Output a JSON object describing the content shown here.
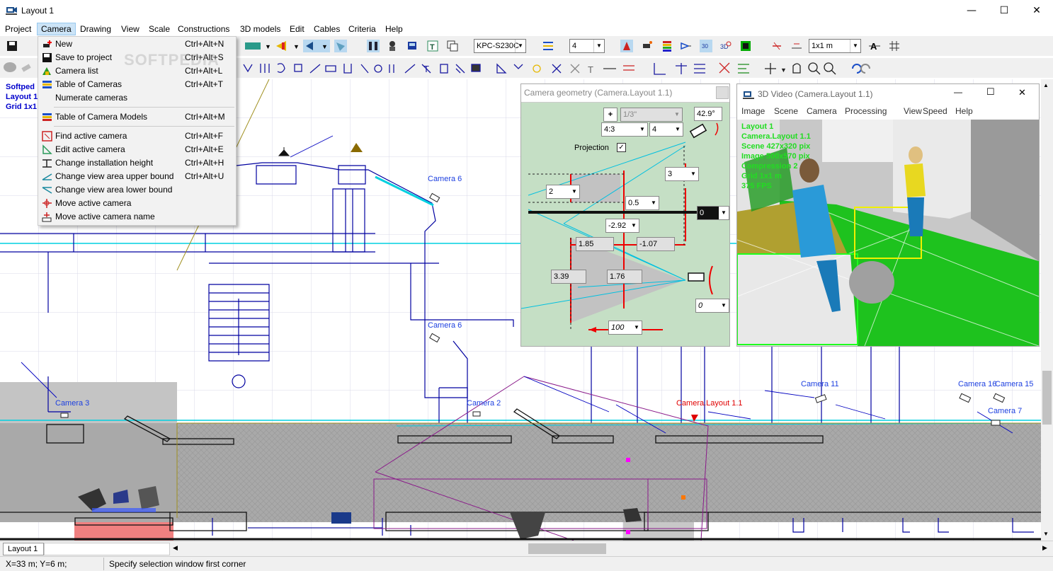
{
  "window": {
    "title": "Layout 1"
  },
  "menubar": [
    "Project",
    "Camera",
    "Drawing",
    "View",
    "Scale",
    "Constructions",
    "3D models",
    "Edit",
    "Cables",
    "Criteria",
    "Help"
  ],
  "toolbar": {
    "camera_model": "KPC-S230C",
    "number_combo": "4",
    "grid_combo": "1x1 m"
  },
  "camera_menu": [
    {
      "label": "New",
      "shortcut": "Ctrl+Alt+N",
      "icon": "new-camera-icon"
    },
    {
      "label": "Save to project",
      "shortcut": "Ctrl+Alt+S",
      "icon": "save-icon"
    },
    {
      "label": "Camera list",
      "shortcut": "Ctrl+Alt+L",
      "icon": "camera-list-icon"
    },
    {
      "label": "Table of Cameras",
      "shortcut": "Ctrl+Alt+T",
      "icon": "table-icon"
    },
    {
      "label": "Numerate cameras",
      "shortcut": "",
      "icon": ""
    },
    {
      "label": "Table of Camera Models",
      "shortcut": "Ctrl+Alt+M",
      "icon": "table-icon"
    },
    {
      "label": "Find active camera",
      "shortcut": "Ctrl+Alt+F",
      "icon": "find-icon"
    },
    {
      "label": "Edit active camera",
      "shortcut": "Ctrl+Alt+E",
      "icon": "edit-icon"
    },
    {
      "label": "Change installation height",
      "shortcut": "Ctrl+Alt+H",
      "icon": "height-icon"
    },
    {
      "label": "Change view area upper bound",
      "shortcut": "Ctrl+Alt+U",
      "icon": "upper-bound-icon"
    },
    {
      "label": "Change view area lower bound",
      "shortcut": "",
      "icon": "lower-bound-icon"
    },
    {
      "label": "Move active camera",
      "shortcut": "",
      "icon": "move-icon"
    },
    {
      "label": "Move active camera name",
      "shortcut": "",
      "icon": "move-name-icon"
    }
  ],
  "canvas": {
    "overlay": [
      "Softped",
      "Layout 1",
      "Grid 1x1"
    ],
    "camera_labels": [
      "Camera 6",
      "Camera 6",
      "Camera 3",
      "Camera 2",
      "Camera.Layout 1.1",
      "Camera 11",
      "Camera 16",
      "Camera 15",
      "Camera 7"
    ],
    "watermark": "SOFTPEDIA"
  },
  "camera_geometry": {
    "title": "Camera geometry (Camera.Layout 1.1)",
    "plus": "+",
    "sensor": "1/3\"",
    "angle": "42.9°",
    "aspect": "4:3",
    "aspect_num": "4",
    "projection_label": "Projection",
    "f3": "3",
    "f2": "2",
    "f05": "0.5",
    "f0": "0",
    "fm292": "-2.92",
    "f185": "1.85",
    "fm107": "-1.07",
    "f339": "3.39",
    "f176": "1.76",
    "f0b": "0",
    "f100": "100"
  },
  "video3d": {
    "title": "3D Video (Camera.Layout 1.1)",
    "menu": [
      "Image",
      "Scene",
      "Camera",
      "Processing",
      "View",
      "Speed",
      "Help"
    ],
    "info": [
      "Layout 1",
      "Camera.Layout 1.1",
      "Scene 427x320 pix",
      "Image 500x570 pix",
      "Compression 2",
      "Grid 1x1 m",
      "375 FPS"
    ]
  },
  "tabs": [
    "Layout 1"
  ],
  "status": {
    "coords": "X=33 m; Y=6 m;",
    "message": "Specify selection window first corner"
  }
}
